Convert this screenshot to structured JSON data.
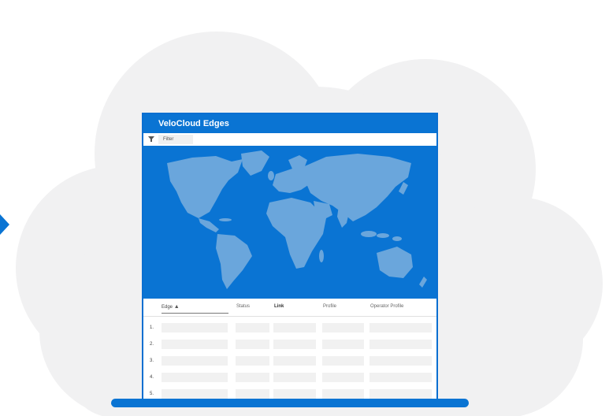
{
  "panel": {
    "title": "VeloCloud Edges"
  },
  "filter": {
    "label": "Filter",
    "icon": "funnel-icon"
  },
  "table": {
    "columns": [
      "Edge",
      "Status",
      "Link",
      "Profile",
      "Operator Profile"
    ],
    "sort": {
      "column": "Edge",
      "direction": "ascending",
      "icon": "sort-up-icon"
    },
    "rows": [
      "1.",
      "2.",
      "3.",
      "4.",
      "5."
    ]
  },
  "colors": {
    "accent": "#0a74d3",
    "cloud": "#f1f1f2",
    "land": "#6aa6dc",
    "placeholder": "#f1f1f1"
  }
}
